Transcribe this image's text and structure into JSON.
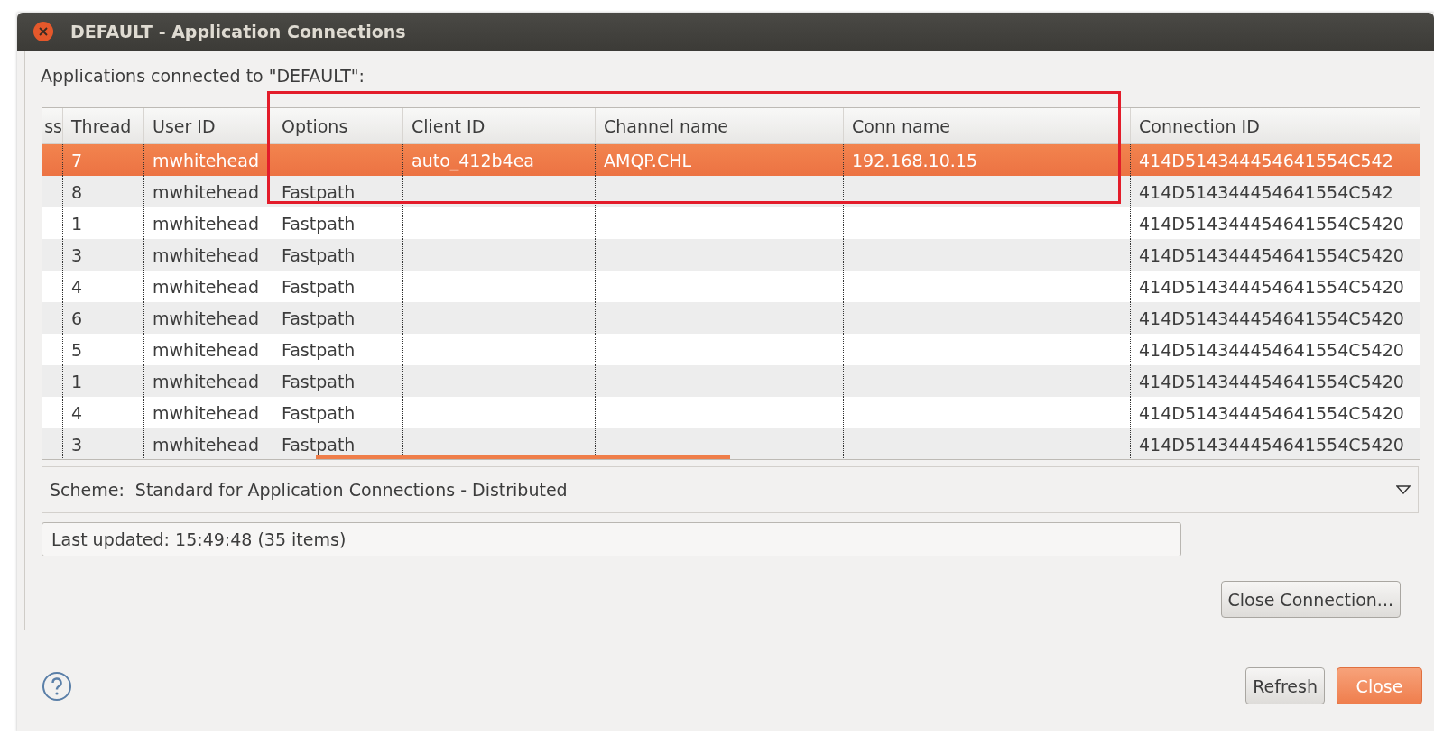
{
  "window": {
    "title": "DEFAULT - Application Connections"
  },
  "heading": "Applications connected to \"DEFAULT\":",
  "table": {
    "columns": [
      "ss",
      "Thread",
      "User ID",
      "Options",
      "Client ID",
      "Channel name",
      "Conn name",
      "Connection ID"
    ],
    "rows": [
      {
        "thread": "7",
        "user_id": "mwhitehead",
        "client_id": "auto_412b4ea",
        "channel_name": "AMQP.CHL",
        "conn_name": "192.168.10.15",
        "connection_id": "414D514344454641554C542",
        "selected": true
      },
      {
        "thread": "8",
        "user_id": "mwhitehead",
        "options": "Fastpath",
        "connection_id": "414D514344454641554C542",
        "selected": false
      },
      {
        "thread": "1",
        "user_id": "mwhitehead",
        "options": "Fastpath",
        "connection_id": "414D514344454641554C5420",
        "selected": false
      },
      {
        "thread": "3",
        "user_id": "mwhitehead",
        "options": "Fastpath",
        "connection_id": "414D514344454641554C5420",
        "selected": false
      },
      {
        "thread": "4",
        "user_id": "mwhitehead",
        "options": "Fastpath",
        "connection_id": "414D514344454641554C5420",
        "selected": false
      },
      {
        "thread": "6",
        "user_id": "mwhitehead",
        "options": "Fastpath",
        "connection_id": "414D514344454641554C5420",
        "selected": false
      },
      {
        "thread": "5",
        "user_id": "mwhitehead",
        "options": "Fastpath",
        "connection_id": "414D514344454641554C5420",
        "selected": false
      },
      {
        "thread": "1",
        "user_id": "mwhitehead",
        "options": "Fastpath",
        "connection_id": "414D514344454641554C5420",
        "selected": false
      },
      {
        "thread": "4",
        "user_id": "mwhitehead",
        "options": "Fastpath",
        "connection_id": "414D514344454641554C5420",
        "selected": false
      },
      {
        "thread": "3",
        "user_id": "mwhitehead",
        "options": "Fastpath",
        "connection_id": "414D514344454641554C5420",
        "selected": false
      }
    ]
  },
  "scheme": {
    "label": "Scheme:",
    "value": "Standard for Application Connections - Distributed"
  },
  "status": "Last updated: 15:49:48 (35 items)",
  "buttons": [
    {
      "label": "Close Connection...",
      "kind": "plain"
    },
    {
      "label": "Refresh",
      "kind": "plain"
    },
    {
      "label": "Close",
      "kind": "default"
    }
  ]
}
